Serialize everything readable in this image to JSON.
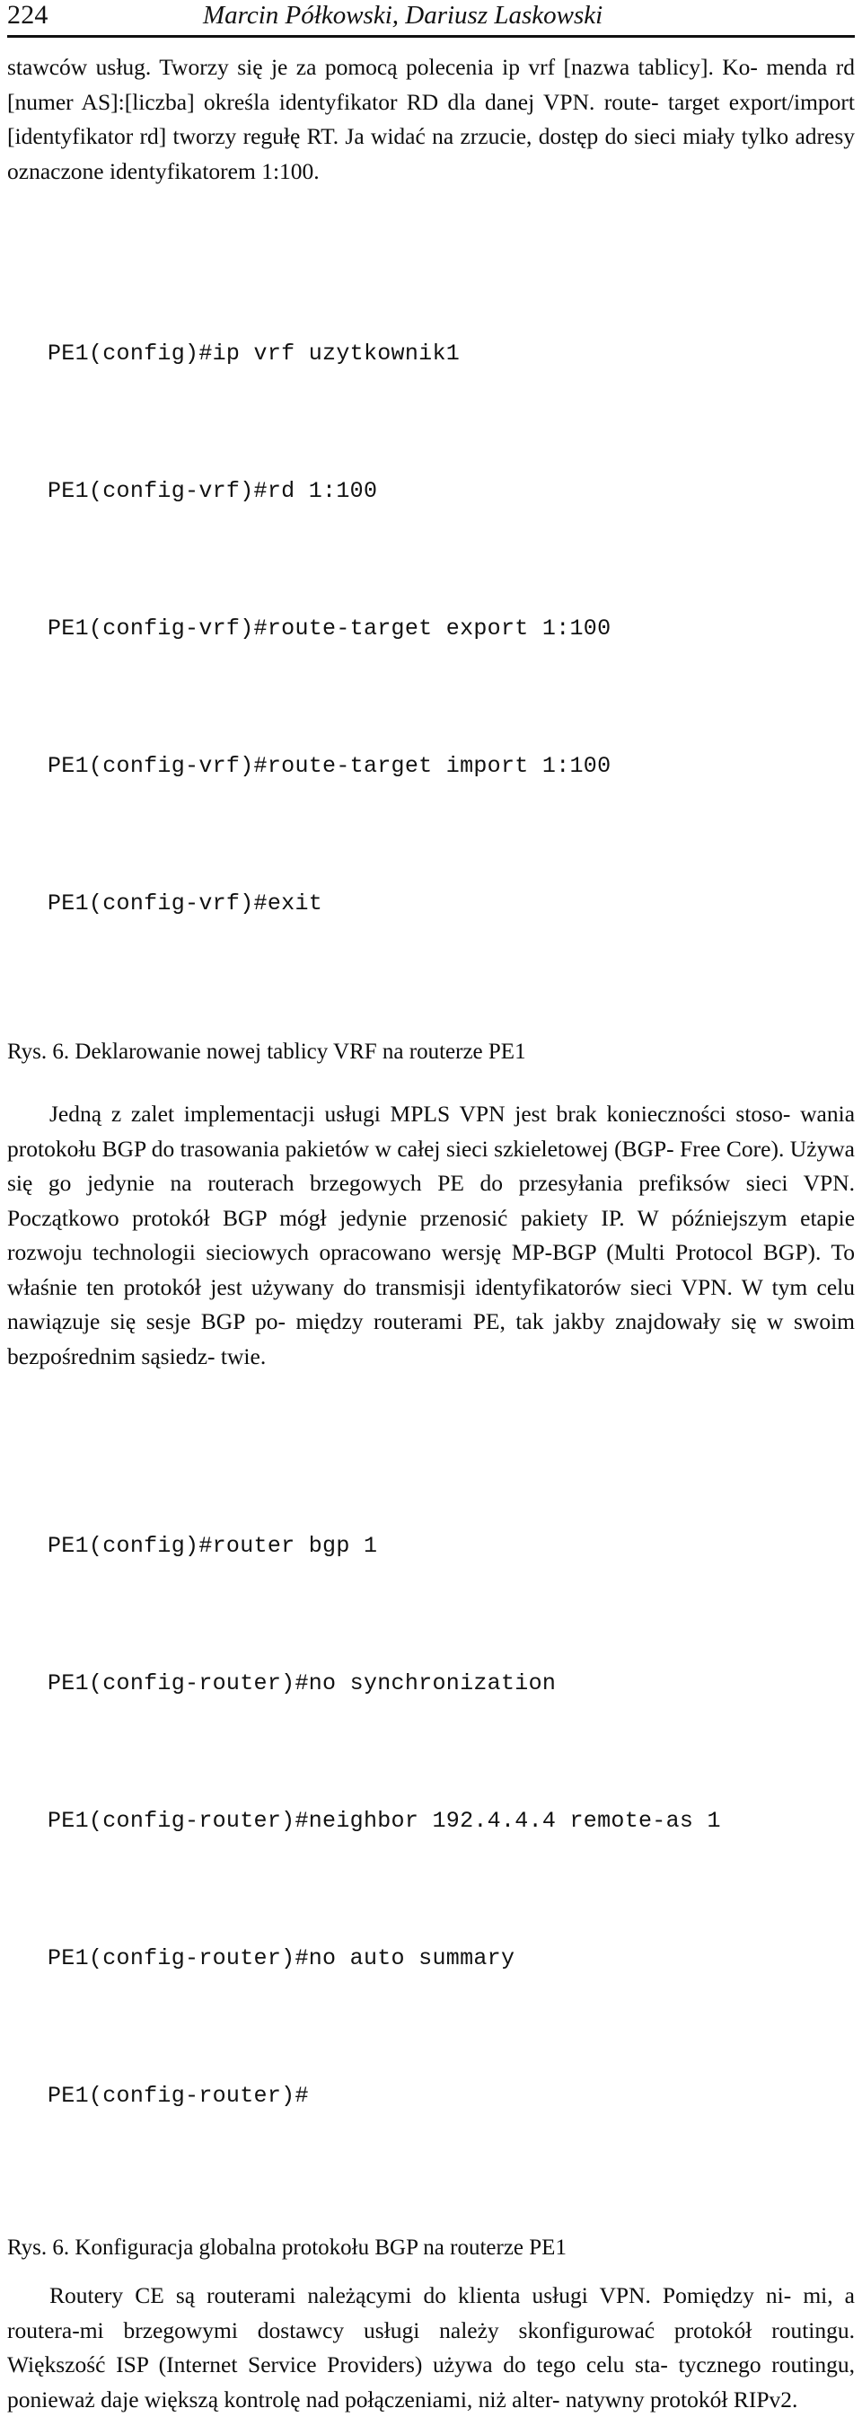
{
  "header": {
    "page_number": "224",
    "authors": "Marcin Półkowski, Dariusz Laskowski"
  },
  "body": {
    "paragraph_1_lines": [
      "stawców usług. Tworzy się je za pomocą polecenia ip vrf [nazwa tablicy]. Ko-",
      "menda rd [numer AS]:[liczba] określa identyfikator RD dla danej VPN. route-",
      "target export/import [identyfikator rd] tworzy regułę RT. Ja widać na zrzucie,",
      "dostęp do sieci miały tylko adresy oznaczone identyfikatorem 1:100."
    ],
    "paragraph_2_lines": [
      "Jedną z zalet implementacji usługi MPLS VPN jest brak konieczności stoso-",
      "wania protokołu BGP do trasowania pakietów w całej sieci szkieletowej (BGP-",
      "Free Core). Używa się go jedynie na routerach brzegowych PE do przesyłania",
      "prefiksów sieci VPN. Początkowo protokół BGP mógł jedynie przenosić pakiety",
      "IP. W późniejszym etapie rozwoju technologii sieciowych opracowano wersję",
      "MP-BGP (Multi Protocol BGP). To właśnie ten protokół jest używany do",
      "transmisji identyfikatorów sieci VPN. W tym celu nawiązuje się sesje BGP po-",
      "między routerami PE, tak jakby znajdowały się w swoim bezpośrednim sąsiedz-",
      "twie."
    ],
    "paragraph_3_lines": [
      "Routery CE są routerami należącymi do klienta usługi VPN. Pomiędzy ni-",
      "mi, a routera-mi brzegowymi dostawcy usługi należy skonfigurować protokół",
      "routingu. Większość ISP (Internet Service Providers) używa do tego celu sta-",
      "tycznego routingu, ponieważ daje większą kontrolę nad połączeniami, niż alter-",
      "natywny protokół RIPv2."
    ]
  },
  "code_block_1": {
    "lines": [
      "PE1(config)#ip vrf uzytkownik1",
      "PE1(config-vrf)#rd 1:100",
      "PE1(config-vrf)#route-target export 1:100",
      "PE1(config-vrf)#route-target import 1:100",
      "PE1(config-vrf)#exit"
    ]
  },
  "code_block_2": {
    "lines": [
      "PE1(config)#router bgp 1",
      "PE1(config-router)#no synchronization",
      "PE1(config-router)#neighbor 192.4.4.4 remote-as 1",
      "PE1(config-router)#no auto summary",
      "PE1(config-router)#"
    ]
  },
  "captions": {
    "figure_6a": "Rys. 6. Deklarowanie nowej tablicy VRF na routerze PE1",
    "figure_6b": "Rys. 6. Konfiguracja globalna protokołu BGP na routerze PE1"
  },
  "colors": {
    "text": "#0d0d0d",
    "rule": "#111111",
    "background": "#ffffff"
  }
}
